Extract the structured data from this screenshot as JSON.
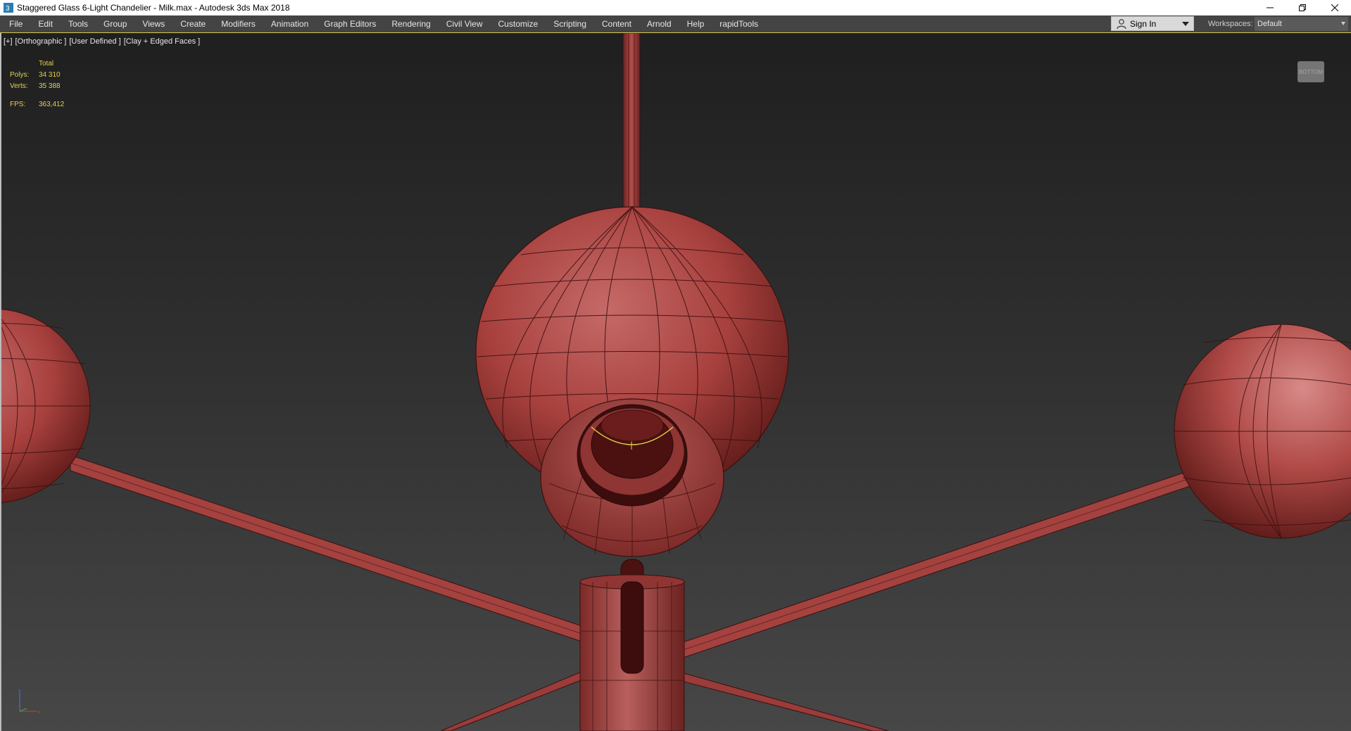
{
  "window": {
    "title": "Staggered Glass 6-Light Chandelier - Milk.max - Autodesk 3ds Max 2018",
    "controls": [
      "minimize-icon",
      "restore-icon",
      "close-icon"
    ]
  },
  "menu": {
    "items": [
      "File",
      "Edit",
      "Tools",
      "Group",
      "Views",
      "Create",
      "Modifiers",
      "Animation",
      "Graph Editors",
      "Rendering",
      "Civil View",
      "Customize",
      "Scripting",
      "Content",
      "Arnold",
      "Help",
      "rapidTools"
    ]
  },
  "account": {
    "sign_in": "Sign In"
  },
  "workspaces": {
    "label": "Workspaces:",
    "value": "Default"
  },
  "viewport": {
    "labels": [
      "[+]",
      "[Orthographic ]",
      "[User Defined ]",
      "[Clay + Edged Faces ]"
    ],
    "stats": {
      "header": "Total",
      "polys_label": "Polys:",
      "polys": "34 310",
      "verts_label": "Verts:",
      "verts": "35 388",
      "fps_label": "FPS:",
      "fps": "363,412"
    },
    "viewcube_label": "BOTTOM"
  },
  "colors": {
    "stats": "#e6d24a",
    "clay": "#a03c3a",
    "accent": "#d8c94f"
  }
}
